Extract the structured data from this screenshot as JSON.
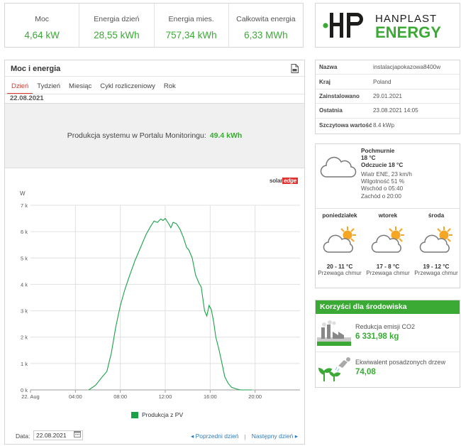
{
  "stats": [
    {
      "label": "Moc",
      "value": "4,64 kW"
    },
    {
      "label": "Energia dzień",
      "value": "28,55 kWh"
    },
    {
      "label": "Energia mies.",
      "value": "757,34 kWh"
    },
    {
      "label": "Całkowita energia",
      "value": "6,33 MWh"
    }
  ],
  "logo": {
    "brand_top": "HANPLAST",
    "brand_bottom": "ENERGY",
    "accent_color": "#3aaa35",
    "dark_color": "#1d1d1b"
  },
  "main": {
    "title": "Moc i energia",
    "tabs": [
      "Dzień",
      "Tydzień",
      "Miesiąc",
      "Cykl rozliczeniowy",
      "Rok"
    ],
    "active_tab": "Dzień",
    "date": "22.08.2021",
    "production_label": "Produkcja systemu w Portalu Monitoringu:",
    "production_value": "49.4 kWh",
    "solaredge_brand": "solar",
    "solaredge_brand_tail": "edge",
    "legend": "Produkcja z PV",
    "footer": {
      "data_label": "Data:",
      "date_value": "22.08.2021",
      "prev": "Poprzedni dzień",
      "next": "Następny dzień"
    }
  },
  "chart_data": {
    "type": "area",
    "ylabel": "W",
    "y_ticks": [
      "0 k",
      "1 k",
      "2 k",
      "3 k",
      "4 k",
      "5 k",
      "6 k",
      "7 k"
    ],
    "ylim": [
      0,
      7000
    ],
    "x_ticks": [
      "22. Aug",
      "04:00",
      "08:00",
      "12:00",
      "16:00",
      "20:00"
    ],
    "xlim_hours": [
      0,
      24
    ],
    "grid": true,
    "series": [
      {
        "name": "Produkcja z PV",
        "color": "#1aa147",
        "x_hours": [
          5.2,
          5.8,
          6.3,
          6.8,
          7.2,
          7.6,
          8.0,
          8.4,
          8.8,
          9.3,
          9.8,
          10.3,
          10.7,
          11.0,
          11.3,
          11.6,
          11.8,
          12.0,
          12.3,
          12.5,
          12.7,
          13.0,
          13.3,
          13.6,
          13.9,
          14.1,
          14.4,
          14.7,
          15.0,
          15.2,
          15.5,
          15.7,
          15.9,
          16.1,
          16.3,
          16.5,
          16.8,
          17.0,
          17.3,
          17.6,
          17.9,
          18.3,
          18.7,
          19.2,
          19.7
        ],
        "values": [
          0,
          180,
          450,
          700,
          1400,
          2400,
          3200,
          3800,
          4300,
          4900,
          5400,
          5900,
          6200,
          6400,
          6350,
          6480,
          6420,
          6500,
          6300,
          6150,
          6350,
          6300,
          6100,
          5800,
          5400,
          5300,
          5000,
          4350,
          4050,
          3900,
          3000,
          2800,
          3200,
          3050,
          2600,
          2000,
          1500,
          1100,
          500,
          250,
          100,
          40,
          0,
          0,
          0
        ]
      }
    ]
  },
  "info": [
    {
      "key": "Nazwa",
      "value": "instalacjapokazowa8400w"
    },
    {
      "key": "Kraj",
      "value": "Poland"
    },
    {
      "key": "Zainstalowano",
      "value": "29.01.2021"
    },
    {
      "key": "Ostatnia",
      "value": "23.08.2021 14:05"
    },
    {
      "key": "Szczytowa wartość",
      "value": "8.4 kWp"
    }
  ],
  "weather": {
    "condition": "Pochmurnie",
    "temp": "18 °C",
    "feels": "Odczucie 18 °C",
    "wind": "Wiatr ENE, 23 km/h",
    "humidity": "Wilgotność 51 %",
    "sunrise": "Wschód o 05:40",
    "sunset": "Zachód o 20:00",
    "forecast": [
      {
        "day": "poniedziałek",
        "temp": "20 - 11 °C",
        "desc": "Przewaga chmur"
      },
      {
        "day": "wtorek",
        "temp": "17 - 8 °C",
        "desc": "Przewaga chmur"
      },
      {
        "day": "środa",
        "temp": "19 - 12 °C",
        "desc": "Przewaga chmur"
      }
    ]
  },
  "env": {
    "title": "Korzyści dla środowiska",
    "co2_label": "Redukcja emisji CO2",
    "co2_value": "6 331,98 kg",
    "trees_label": "Ekwiwalent posadzonych drzew",
    "trees_value": "74,08"
  }
}
